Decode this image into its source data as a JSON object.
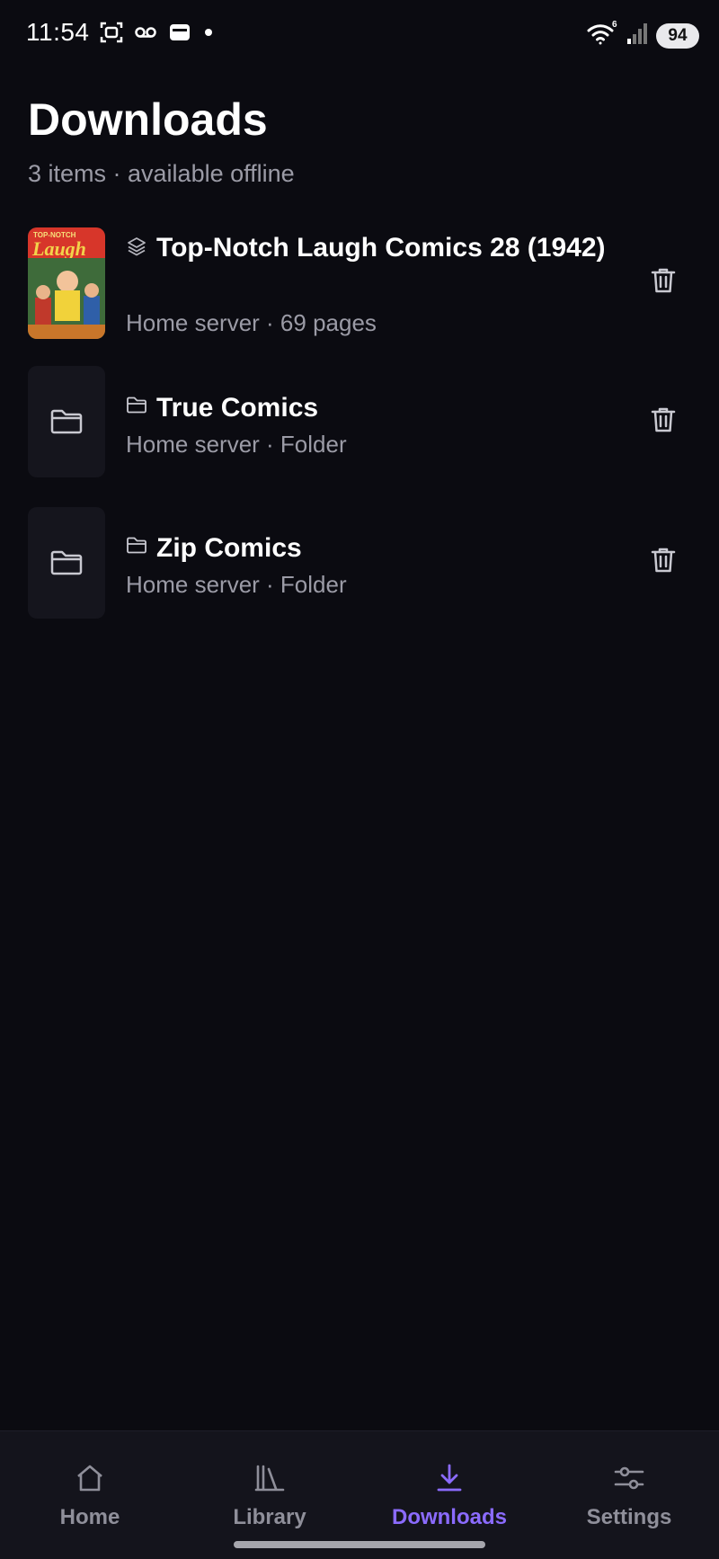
{
  "status_bar": {
    "time": "11:54",
    "battery": "94"
  },
  "header": {
    "title": "Downloads",
    "subtitle": "3 items · available offline"
  },
  "items": [
    {
      "title": "Top-Notch Laugh Comics 28 (1942)",
      "meta": "Home server · 69 pages",
      "type_icon": "layers-icon",
      "cover_text_top": "TOP-NOTCH",
      "cover_text_main": "Laugh"
    },
    {
      "title": "True Comics",
      "meta": "Home server · Folder",
      "type_icon": "folder-icon"
    },
    {
      "title": "Zip Comics",
      "meta": "Home server · Folder",
      "type_icon": "folder-icon"
    }
  ],
  "bottom_nav": [
    {
      "label": "Home",
      "icon": "home-icon"
    },
    {
      "label": "Library",
      "icon": "library-icon"
    },
    {
      "label": "Downloads",
      "icon": "download-icon",
      "active": true
    },
    {
      "label": "Settings",
      "icon": "sliders-icon"
    }
  ],
  "colors": {
    "background": "#0b0b11",
    "accent": "#8b6bff",
    "muted_text": "#9b9ba6"
  }
}
